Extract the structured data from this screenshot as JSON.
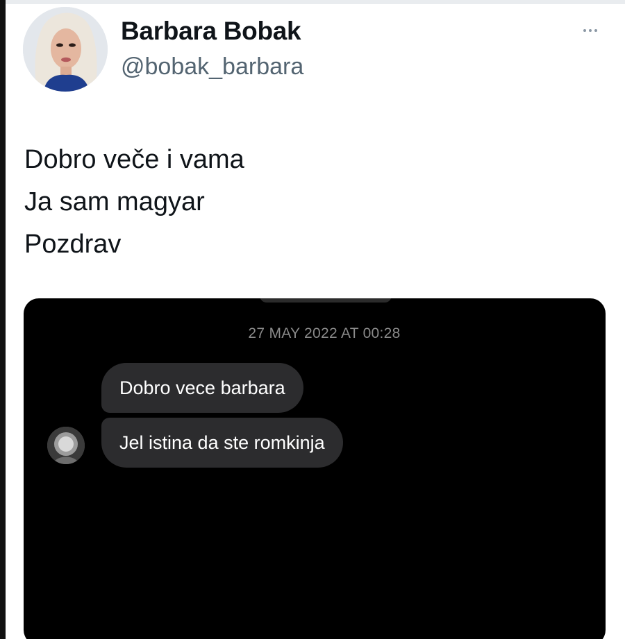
{
  "tweet": {
    "author": {
      "name": "Barbara Bobak",
      "handle": "@bobak_barbara"
    },
    "text_lines": [
      "Dobro veče i vama",
      "Ja sam magyar",
      "Pozdrav"
    ]
  },
  "media": {
    "timestamp": "27 MAY 2022 AT 00:28",
    "messages": [
      {
        "text": "Dobro vece barbara"
      },
      {
        "text": "Jel istina da ste romkinja"
      }
    ]
  },
  "icons": {
    "more": "more-horizontal-icon"
  },
  "colors": {
    "name": "#0f1419",
    "handle": "#536471",
    "media_background": "#000000",
    "bubble": "#2c2c2e",
    "timestamp": "#8a8a8a"
  }
}
